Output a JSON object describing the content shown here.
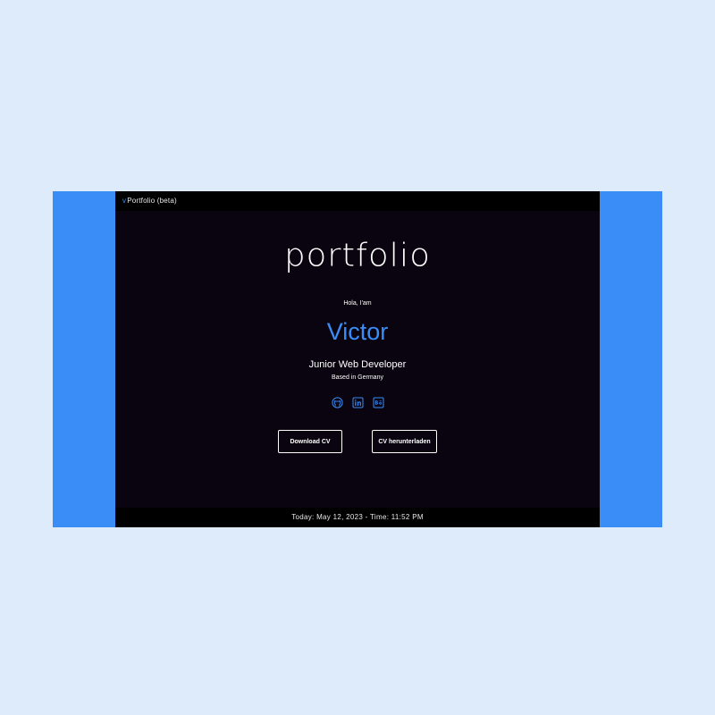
{
  "topbar": {
    "logo_mark": "v",
    "brand": "Portfolio (beta)"
  },
  "hero": {
    "logo_text": "portfolio",
    "greeting": "Hola, I'am",
    "name": "Victor",
    "role": "Junior Web Developer",
    "location": "Based in Germany"
  },
  "socials": [
    {
      "icon": "github-icon"
    },
    {
      "icon": "linkedin-icon"
    },
    {
      "icon": "behance-icon"
    }
  ],
  "buttons": {
    "download_cv": "Download CV",
    "download_cv_de": "CV herunterladen"
  },
  "footer": {
    "text": "Today: May 12, 2023 - Time: 11:52 PM"
  },
  "colors": {
    "accent": "#3a8cf7",
    "page_background": "#deebfb",
    "screen_background": "#0a0410",
    "bar_background": "#000000"
  }
}
